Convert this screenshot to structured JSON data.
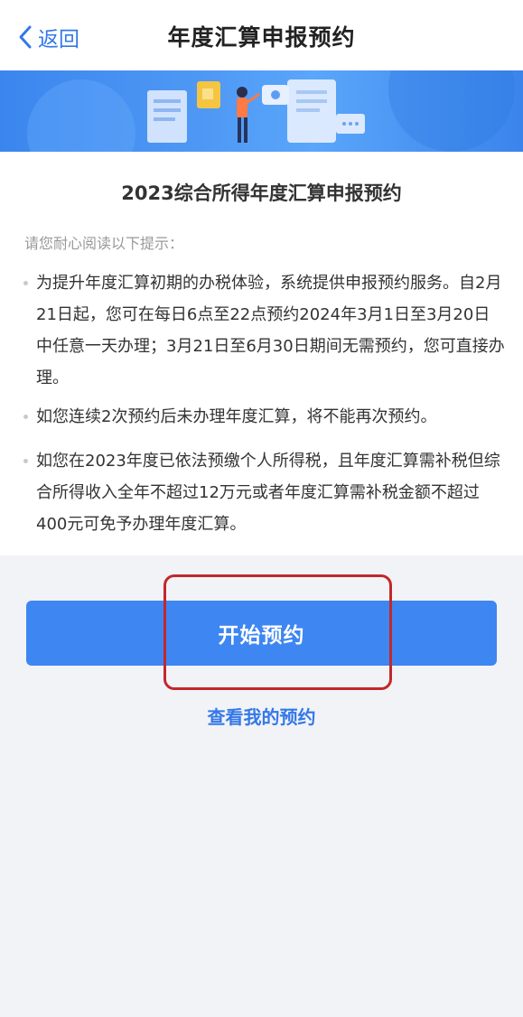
{
  "nav": {
    "back_label": "返回",
    "title": "年度汇算申报预约"
  },
  "card": {
    "title": "2023综合所得年度汇算申报预约",
    "hint": "请您耐心阅读以下提示：",
    "tips": [
      "为提升年度汇算初期的办税体验，系统提供申报预约服务。自2月21日起，您可在每日6点至22点预约2024年3月1日至3月20日中任意一天办理；3月21日至6月30日期间无需预约，您可直接办理。",
      "如您连续2次预约后未办理年度汇算，将不能再次预约。",
      "如您在2023年度已依法预缴个人所得税，且年度汇算需补税但综合所得收入全年不超过12万元或者年度汇算需补税金额不超过400元可免予办理年度汇算。"
    ]
  },
  "actions": {
    "start_label": "开始预约",
    "view_label": "查看我的预约"
  },
  "colors": {
    "accent": "#3e86f2",
    "link": "#3478e8",
    "highlight": "#c2282c"
  }
}
